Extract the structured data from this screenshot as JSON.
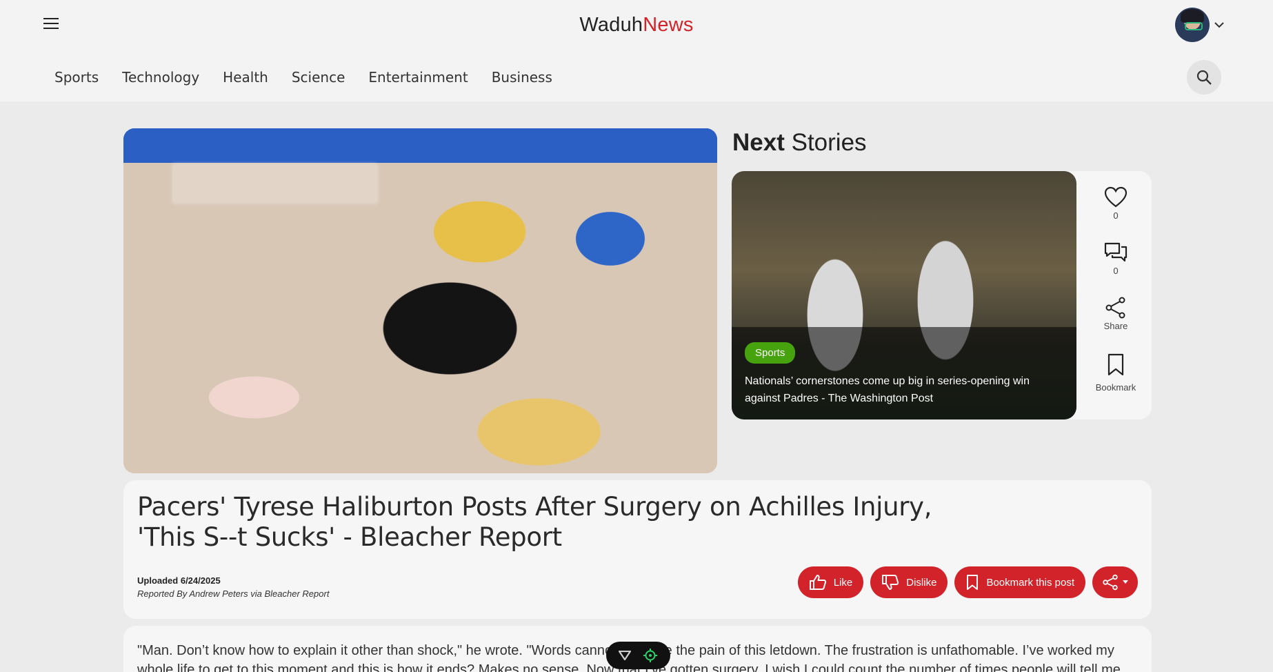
{
  "header": {
    "brand_part1": "Waduh",
    "brand_part2": "News",
    "nav": [
      "Sports",
      "Technology",
      "Health",
      "Science",
      "Entertainment",
      "Business"
    ]
  },
  "next_stories": {
    "title_bold": "Next",
    "title_rest": " Stories",
    "story": {
      "category": "Sports",
      "headline": "Nationals’ cornerstones come up big in series-opening win against Padres - The Washington Post"
    },
    "actions": {
      "like_count": "0",
      "comment_count": "0",
      "share_label": "Share",
      "bookmark_label": "Bookmark"
    }
  },
  "article": {
    "title": "Pacers' Tyrese Haliburton Posts After Surgery on Achilles Injury, 'This S--t Sucks' - Bleacher Report",
    "uploaded": "Uploaded 6/24/2025",
    "reported_by": "Reported By Andrew Peters via Bleacher Report",
    "buttons": {
      "like": "Like",
      "dislike": "Dislike",
      "bookmark": "Bookmark this post"
    },
    "body": "\"Man. Don’t know how to explain it other than shock,\" he wrote. \"Words cannot describe the pain of this letdown. The frustration is unfathomable. I’ve worked my whole life to get to this moment and this is how it ends? Makes no sense. Now that I’ve gotten surgery, I wish I could count the number of times people will tell me"
  },
  "colors": {
    "accent": "#d3232a",
    "tag": "#46a30e"
  }
}
